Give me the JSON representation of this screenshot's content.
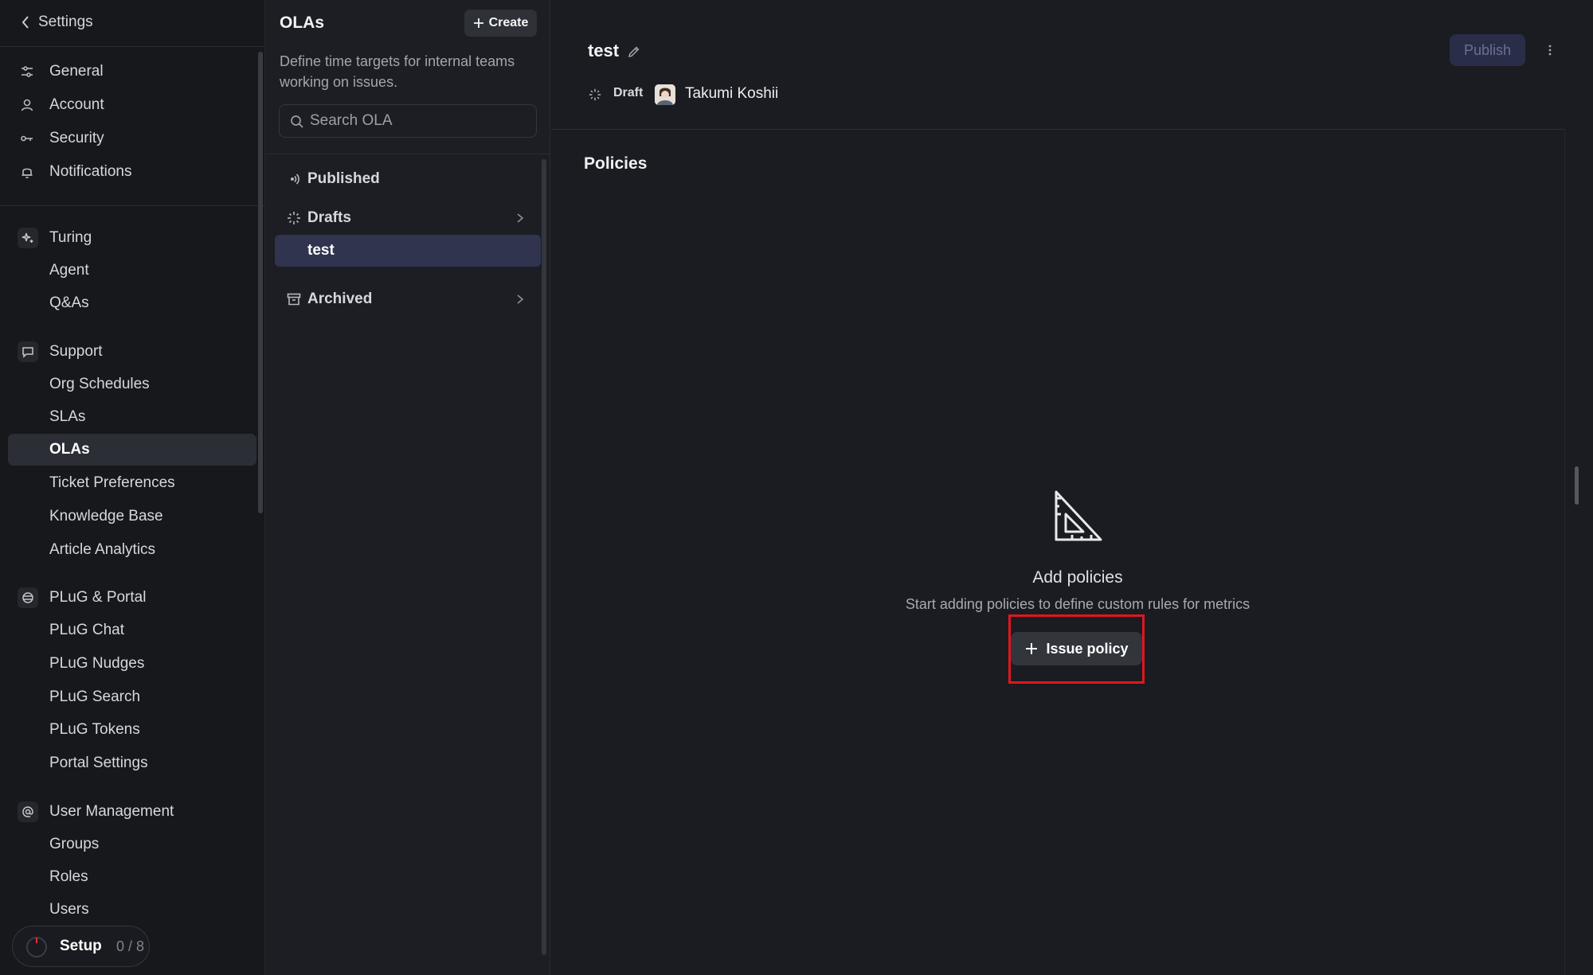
{
  "sidebar": {
    "back_label": "Settings",
    "items": [
      {
        "label": "General",
        "icon": "sliders-icon"
      },
      {
        "label": "Account",
        "icon": "user-icon"
      },
      {
        "label": "Security",
        "icon": "key-icon"
      },
      {
        "label": "Notifications",
        "icon": "bell-icon"
      }
    ],
    "sections": [
      {
        "label": "Turing",
        "icon": "sparkle-icon",
        "children": [
          "Agent",
          "Q&As"
        ]
      },
      {
        "label": "Support",
        "icon": "chat-icon",
        "children": [
          "Org Schedules",
          "SLAs",
          "OLAs",
          "Ticket Preferences",
          "Knowledge Base",
          "Article Analytics"
        ]
      },
      {
        "label": "PLuG & Portal",
        "icon": "globe-icon",
        "children": [
          "PLuG Chat",
          "PLuG Nudges",
          "PLuG Search",
          "PLuG Tokens",
          "Portal Settings"
        ]
      },
      {
        "label": "User Management",
        "icon": "at-icon",
        "children": [
          "Groups",
          "Roles",
          "Users"
        ]
      }
    ],
    "active_item": "OLAs",
    "setup": {
      "label": "Setup",
      "progress": "0 / 8"
    }
  },
  "ola_panel": {
    "title": "OLAs",
    "create_label": "Create",
    "description": "Define time targets for internal teams working on issues.",
    "search_placeholder": "Search OLA",
    "groups": [
      {
        "label": "Published",
        "icon": "broadcast-icon",
        "expandable": false
      },
      {
        "label": "Drafts",
        "icon": "draft-icon",
        "expandable": true
      },
      {
        "label": "test",
        "selected": true
      },
      {
        "label": "Archived",
        "icon": "archive-icon",
        "expandable": true
      }
    ]
  },
  "detail": {
    "title": "test",
    "status": "Draft",
    "owner": "Takumi Koshii",
    "publish_label": "Publish",
    "section_title": "Policies",
    "empty_heading": "Add policies",
    "empty_subtext": "Start adding policies to define custom rules for metrics",
    "issue_policy_label": "Issue policy"
  },
  "colors": {
    "background": "#1b1c21",
    "sidebar": "#17181c",
    "selected_row": "#30344f",
    "publish_button": "#2a2d47",
    "highlight": "#e0161d"
  }
}
